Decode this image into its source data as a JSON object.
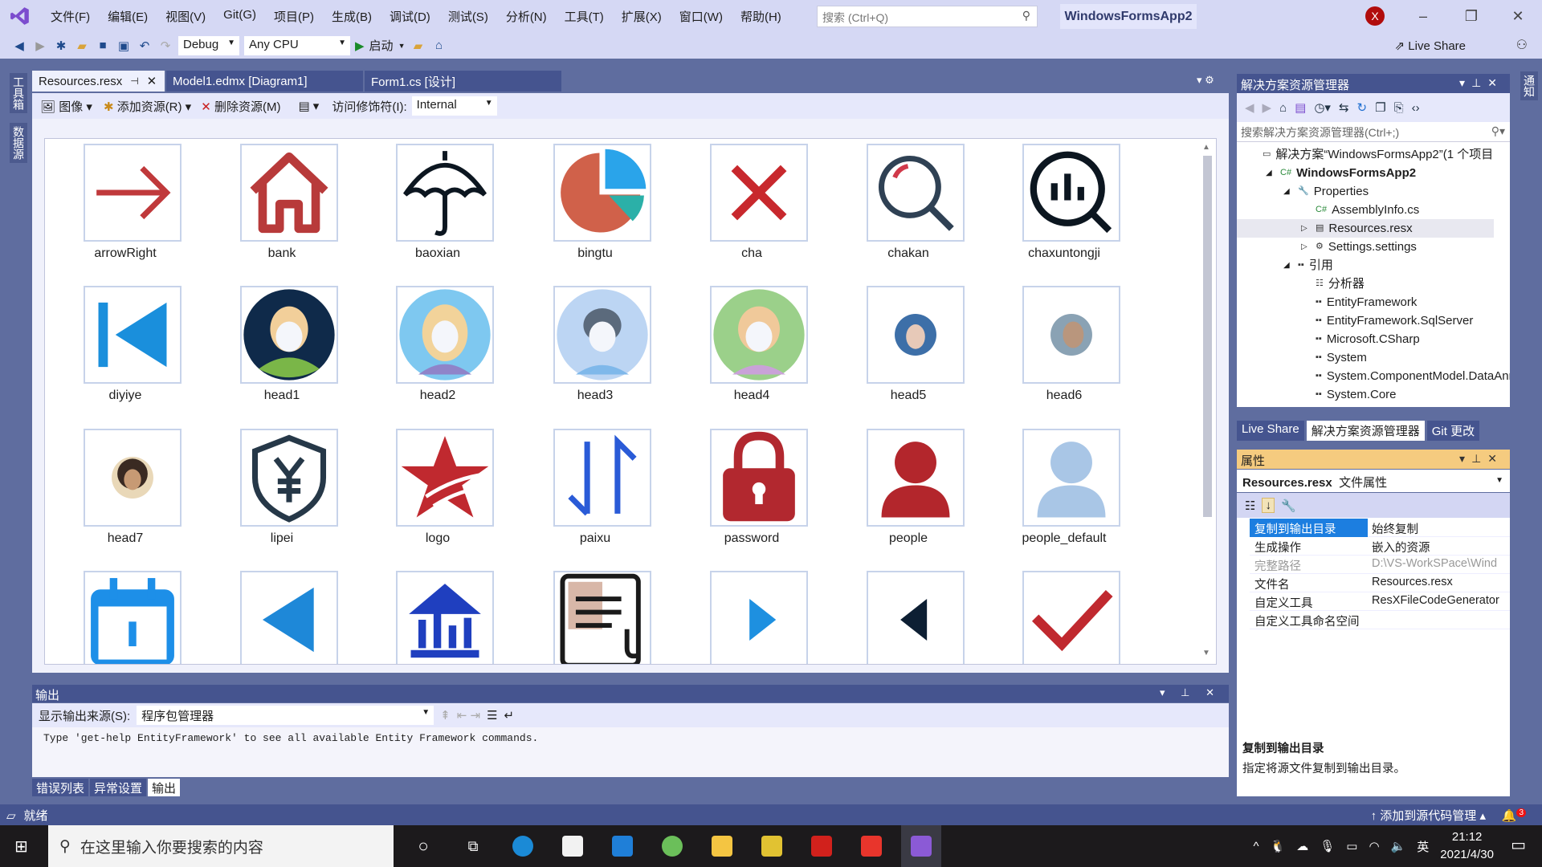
{
  "menubar": {
    "items": [
      "文件(F)",
      "编辑(E)",
      "视图(V)",
      "Git(G)",
      "项目(P)",
      "生成(B)",
      "调试(D)",
      "测试(S)",
      "分析(N)",
      "工具(T)",
      "扩展(X)",
      "窗口(W)",
      "帮助(H)"
    ],
    "search_placeholder": "搜索 (Ctrl+Q)",
    "app_title": "WindowsFormsApp2",
    "user_initial": "X"
  },
  "toolbar": {
    "config": "Debug",
    "platform": "Any CPU",
    "start": "启动",
    "live_share": "Live Share"
  },
  "left_strip": [
    "工具箱",
    "数据源"
  ],
  "right_strip": [
    "通知"
  ],
  "doc_tabs": [
    {
      "label": "Resources.resx",
      "active": true
    },
    {
      "label": "Model1.edmx [Diagram1]"
    },
    {
      "label": "Form1.cs [设计]"
    }
  ],
  "resource_toolbar": {
    "type": "图像",
    "add": "添加资源(R)",
    "remove": "删除资源(M)",
    "access_label": "访问修饰符(I):",
    "access_value": "Internal"
  },
  "resources": [
    {
      "name": "arrowRight",
      "icon": "arrow-right"
    },
    {
      "name": "bank",
      "icon": "house"
    },
    {
      "name": "baoxian",
      "icon": "umbrella"
    },
    {
      "name": "bingtu",
      "icon": "pie-chart"
    },
    {
      "name": "cha",
      "icon": "x-mark"
    },
    {
      "name": "chakan",
      "icon": "magnifier"
    },
    {
      "name": "chaxuntongji",
      "icon": "magnifier-bars"
    },
    {
      "name": "diyiye",
      "icon": "first-page"
    },
    {
      "name": "head1",
      "icon": "avatar-dark"
    },
    {
      "name": "head2",
      "icon": "avatar-blue"
    },
    {
      "name": "head3",
      "icon": "avatar-light"
    },
    {
      "name": "head4",
      "icon": "avatar-green"
    },
    {
      "name": "head5",
      "icon": "photo-woman"
    },
    {
      "name": "head6",
      "icon": "photo-man"
    },
    {
      "name": "head7",
      "icon": "photo-curly"
    },
    {
      "name": "lipei",
      "icon": "shield-yen"
    },
    {
      "name": "logo",
      "icon": "star"
    },
    {
      "name": "paixu",
      "icon": "sort-arrows"
    },
    {
      "name": "password",
      "icon": "lock"
    },
    {
      "name": "people",
      "icon": "person-red"
    },
    {
      "name": "people_default",
      "icon": "person-light"
    },
    {
      "name": "",
      "icon": "calendar"
    },
    {
      "name": "",
      "icon": "triangle-left-blue"
    },
    {
      "name": "",
      "icon": "chart-house"
    },
    {
      "name": "",
      "icon": "document-stethoscope"
    },
    {
      "name": "",
      "icon": "triangle-right-blue"
    },
    {
      "name": "",
      "icon": "triangle-left-dark"
    },
    {
      "name": "",
      "icon": "checkmark"
    }
  ],
  "output": {
    "title": "输出",
    "source_label": "显示输出来源(S):",
    "source_value": "程序包管理器",
    "text": "Type 'get-help EntityFramework' to see all available Entity Framework commands.",
    "tabs": [
      {
        "label": "错误列表"
      },
      {
        "label": "异常设置"
      },
      {
        "label": "输出",
        "active": true
      }
    ]
  },
  "statusbar": {
    "status": "就绪",
    "source_control": "添加到源代码管理",
    "notifications": "3"
  },
  "solution_explorer": {
    "title": "解决方案资源管理器",
    "search_placeholder": "搜索解决方案资源管理器(Ctrl+;)",
    "tree": [
      {
        "label": "解决方案“WindowsFormsApp2”(1 个项目",
        "level": 0,
        "icon": "solution-icon"
      },
      {
        "label": "WindowsFormsApp2",
        "level": 1,
        "icon": "csharp-project-icon",
        "bold": true,
        "expanded": true
      },
      {
        "label": "Properties",
        "level": 2,
        "icon": "wrench-icon",
        "expanded": true
      },
      {
        "label": "AssemblyInfo.cs",
        "level": 3,
        "icon": "csharp-file-icon"
      },
      {
        "label": "Resources.resx",
        "level": 3,
        "icon": "resx-icon",
        "selected": true,
        "collapsed": true
      },
      {
        "label": "Settings.settings",
        "level": 3,
        "icon": "gear-icon",
        "collapsed": true
      },
      {
        "label": "引用",
        "level": 2,
        "icon": "reference-icon",
        "expanded": true
      },
      {
        "label": "分析器",
        "level": 3,
        "icon": "analyzer-icon"
      },
      {
        "label": "EntityFramework",
        "level": 3,
        "icon": "reference-icon"
      },
      {
        "label": "EntityFramework.SqlServer",
        "level": 3,
        "icon": "reference-icon"
      },
      {
        "label": "Microsoft.CSharp",
        "level": 3,
        "icon": "reference-icon"
      },
      {
        "label": "System",
        "level": 3,
        "icon": "reference-icon"
      },
      {
        "label": "System.ComponentModel.DataAnnotations",
        "level": 3,
        "icon": "reference-icon"
      },
      {
        "label": "System.Core",
        "level": 3,
        "icon": "reference-icon"
      }
    ],
    "tabs": [
      {
        "label": "Live Share"
      },
      {
        "label": "解决方案资源管理器",
        "active": true
      },
      {
        "label": "Git 更改"
      }
    ]
  },
  "properties": {
    "title": "属性",
    "object": "Resources.resx",
    "object_type": "文件属性",
    "rows": [
      {
        "k": "复制到输出目录",
        "v": "始终复制",
        "selected": true
      },
      {
        "k": "生成操作",
        "v": "嵌入的资源"
      },
      {
        "k": "完整路径",
        "v": "D:\\VS-WorkSPace\\Wind",
        "disabled": true
      },
      {
        "k": "文件名",
        "v": "Resources.resx"
      },
      {
        "k": "自定义工具",
        "v": "ResXFileCodeGenerator"
      },
      {
        "k": "自定义工具命名空间",
        "v": ""
      }
    ],
    "desc_title": "复制到输出目录",
    "desc_text": "指定将源文件复制到输出目录。"
  },
  "taskbar": {
    "search_placeholder": "在这里输入你要搜索的内容",
    "time": "21:12",
    "date": "2021/4/30",
    "ime": "英"
  },
  "colors": {
    "accent": "#5f6d9f",
    "tab_active": "#eef0fd",
    "properties_header": "#f5cb7f",
    "selection": "#1c7ee0"
  }
}
